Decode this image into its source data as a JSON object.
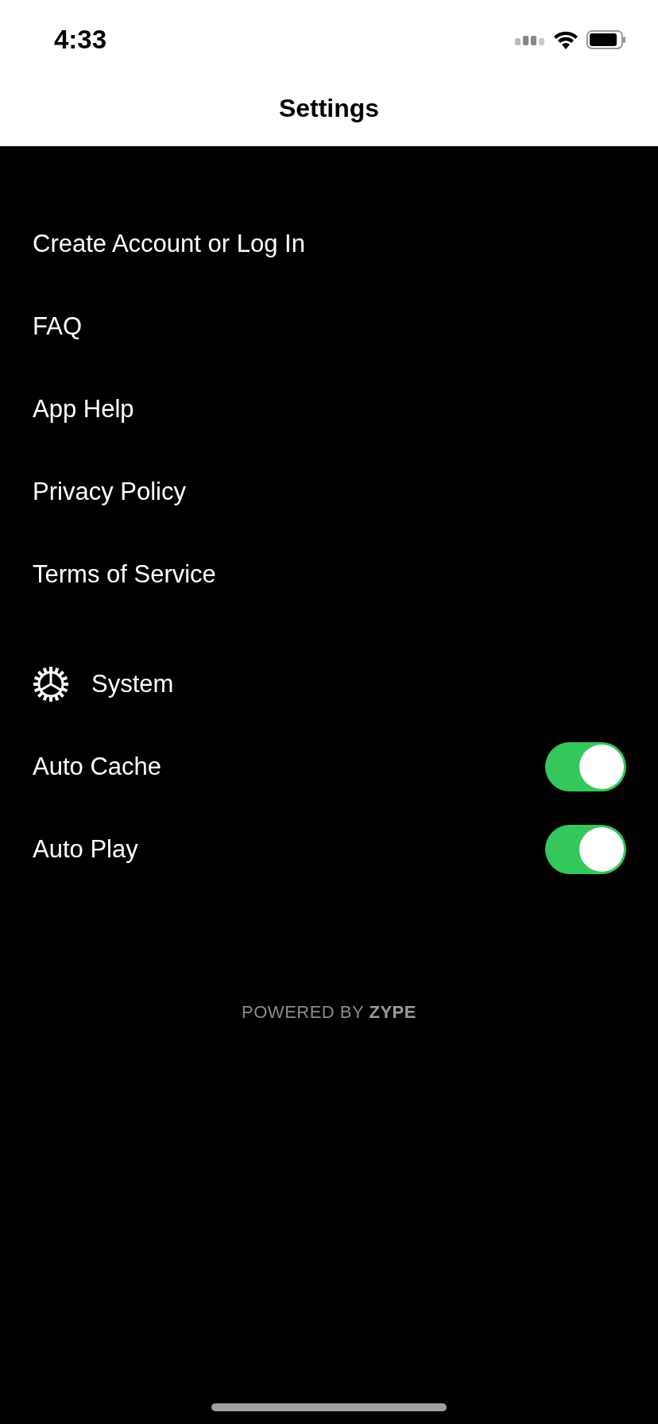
{
  "status_bar": {
    "time": "4:33"
  },
  "nav": {
    "title": "Settings"
  },
  "menu_items": [
    {
      "label": "Create Account or Log In"
    },
    {
      "label": "FAQ"
    },
    {
      "label": "App Help"
    },
    {
      "label": "Privacy Policy"
    },
    {
      "label": "Terms of Service"
    }
  ],
  "system": {
    "title": "System",
    "toggles": [
      {
        "label": "Auto Cache",
        "on": true
      },
      {
        "label": "Auto Play",
        "on": true
      }
    ]
  },
  "footer": "POWERED BY **ZYPE**"
}
